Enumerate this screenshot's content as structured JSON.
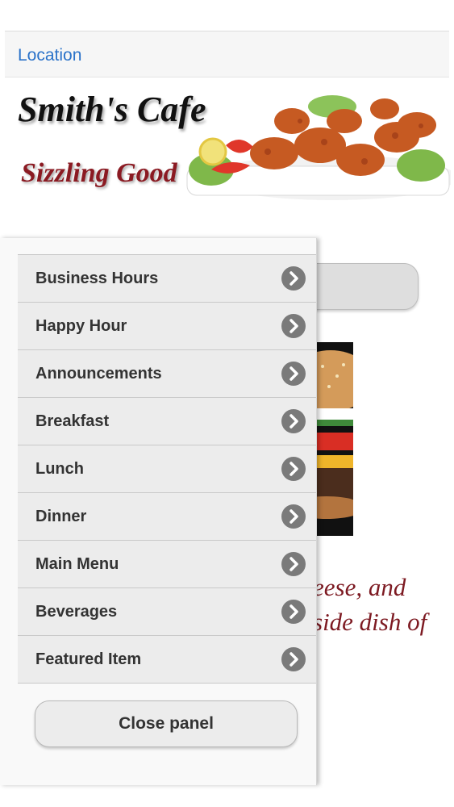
{
  "topbar": {
    "location_link": "Location"
  },
  "banner": {
    "title": "Smith's Cafe",
    "subtitle": "Sizzling Good",
    "image_icon": "fried-chicken-plate-image"
  },
  "background": {
    "text_lines": [
      "eese, and",
      "side dish of"
    ],
    "image_icon": "burger-photo"
  },
  "panel": {
    "items": [
      {
        "label": "Business Hours",
        "icon": "chevron-right-icon"
      },
      {
        "label": "Happy Hour",
        "icon": "chevron-right-icon"
      },
      {
        "label": "Announcements",
        "icon": "chevron-right-icon"
      },
      {
        "label": "Breakfast",
        "icon": "chevron-right-icon"
      },
      {
        "label": "Lunch",
        "icon": "chevron-right-icon"
      },
      {
        "label": "Dinner",
        "icon": "chevron-right-icon"
      },
      {
        "label": "Main Menu",
        "icon": "chevron-right-icon"
      },
      {
        "label": "Beverages",
        "icon": "chevron-right-icon"
      },
      {
        "label": "Featured Item",
        "icon": "chevron-right-icon"
      }
    ],
    "close_label": "Close panel"
  },
  "colors": {
    "link": "#2a72c9",
    "accent_red": "#8b1a22",
    "arrow_badge": "#7a7a7a"
  }
}
